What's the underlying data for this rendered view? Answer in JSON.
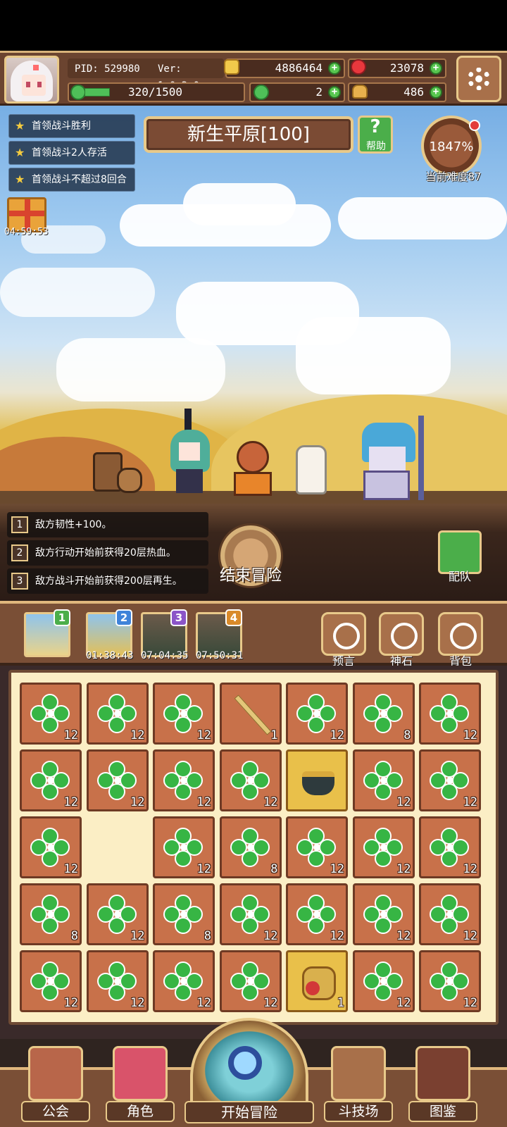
{
  "header": {
    "pid": "PID: 529980",
    "version": "Ver: 1.0.2.0",
    "gold": "4886464",
    "gems": "23078",
    "stamina": "320/1500",
    "clovers": "2",
    "bread": "486"
  },
  "quests": [
    "首领战斗胜利",
    "首领战斗2人存活",
    "首领战斗不超过8回合"
  ],
  "stage": {
    "name": "新生平原[100]",
    "help_label": "帮助"
  },
  "difficulty": {
    "percent": "1847%",
    "label": "当前难度87"
  },
  "gift": {
    "timer": "04:59:53"
  },
  "effects": [
    {
      "num": "1",
      "text": "敌方韧性+100。"
    },
    {
      "num": "2",
      "text": "敌方行动开始前获得20层热血。"
    },
    {
      "num": "3",
      "text": "敌方战斗开始前获得200层再生。"
    }
  ],
  "end_button": {
    "label": "结束冒险"
  },
  "team_button": {
    "label": "配队"
  },
  "maps": [
    {
      "badge": "1",
      "time": ""
    },
    {
      "badge": "2",
      "time": "01:38:43"
    },
    {
      "badge": "3",
      "time": "07:04:35"
    },
    {
      "badge": "4",
      "time": "07:50:31"
    }
  ],
  "side_buttons": {
    "prophecy": "预言",
    "godstone": "神石",
    "bag": "背包"
  },
  "inventory": [
    [
      "clover",
      "12"
    ],
    [
      "clover",
      "12"
    ],
    [
      "clover",
      "12"
    ],
    [
      "stick",
      "1"
    ],
    [
      "clover",
      "12"
    ],
    [
      "clover",
      "8"
    ],
    [
      "clover",
      "12"
    ],
    [
      "clover",
      "12"
    ],
    [
      "clover",
      "12"
    ],
    [
      "clover",
      "12"
    ],
    [
      "clover",
      "12"
    ],
    [
      "pot",
      ""
    ],
    [
      "clover",
      "12"
    ],
    [
      "clover",
      "12"
    ],
    [
      "clover",
      "12"
    ],
    [
      "empty",
      ""
    ],
    [
      "clover",
      "12"
    ],
    [
      "clover",
      "8"
    ],
    [
      "clover",
      "12"
    ],
    [
      "clover",
      "12"
    ],
    [
      "clover",
      "12"
    ],
    [
      "clover",
      "8"
    ],
    [
      "clover",
      "12"
    ],
    [
      "clover",
      "8"
    ],
    [
      "clover",
      "12"
    ],
    [
      "clover",
      "12"
    ],
    [
      "clover",
      "12"
    ],
    [
      "clover",
      "12"
    ],
    [
      "clover",
      "12"
    ],
    [
      "clover",
      "12"
    ],
    [
      "clover",
      "12"
    ],
    [
      "clover",
      "12"
    ],
    [
      "pouch",
      "1"
    ],
    [
      "clover",
      "12"
    ],
    [
      "clover",
      "12"
    ]
  ],
  "nav": {
    "guild": "公会",
    "character": "角色",
    "start": "开始冒险",
    "arena": "斗技场",
    "codex": "图鉴"
  },
  "colors": {
    "accent_green": "#4bae4a",
    "frame_gold": "#e8c98a",
    "slot_brown": "#c8714a"
  }
}
